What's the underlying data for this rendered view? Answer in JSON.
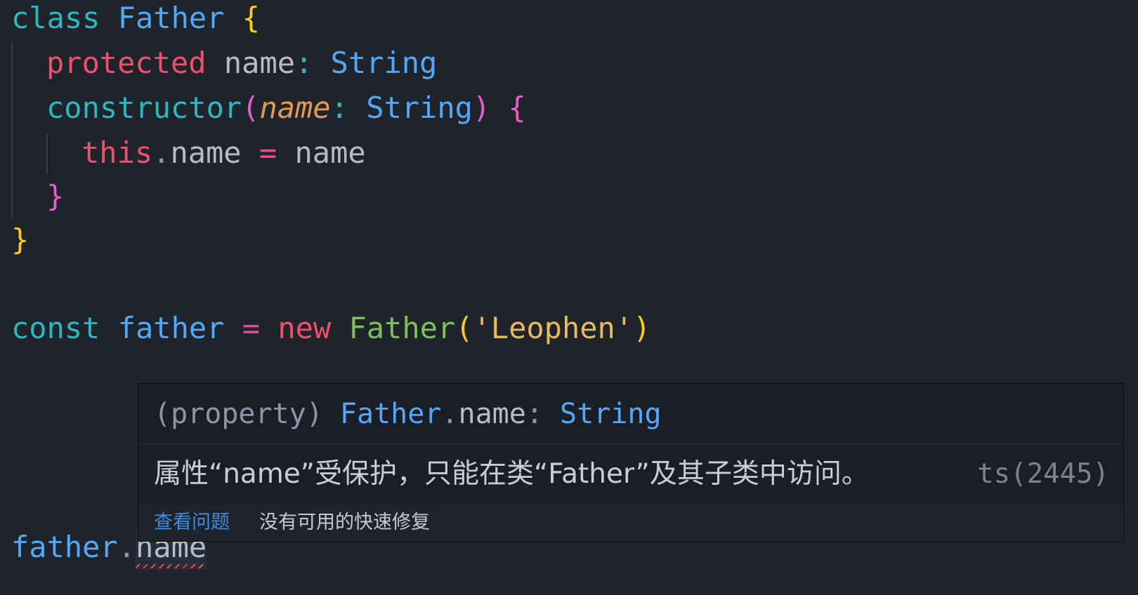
{
  "theme": {
    "background": "#1f232a",
    "accent_blue": "#52a8ff",
    "error_red": "#e5484d"
  },
  "code": {
    "line1": {
      "kw": "class",
      "name": "Father",
      "brace": "{"
    },
    "line2": {
      "mod": "protected",
      "prop": "name",
      "colon": ":",
      "type": "String"
    },
    "line3": {
      "kw": "constructor",
      "paren_open": "(",
      "param": "name",
      "colon": ":",
      "type": "String",
      "paren_close": ")",
      "brace": "{"
    },
    "line4": {
      "this": "this",
      "dot": ".",
      "prop": "name",
      "eq": "=",
      "value": "name"
    },
    "line5": {
      "brace": "}"
    },
    "line6": {
      "brace": "}"
    },
    "line7": {
      "kw": "const",
      "var": "father",
      "eq": "=",
      "new": "new",
      "cls": "Father",
      "paren_open": "(",
      "arg": "'Leophen'",
      "paren_close": ")"
    },
    "line8": {
      "obj": "father",
      "dot": ".",
      "prop": "name"
    }
  },
  "hover": {
    "signature": {
      "prefix": "(property)",
      "owner": "Father",
      "dot": ".",
      "member": "name",
      "colon": ":",
      "type": "String"
    },
    "message": "属性“name”受保护，只能在类“Father”及其子类中访问。",
    "code": "ts(2445)",
    "actions": {
      "view_problem": "查看问题",
      "no_quick_fix": "没有可用的快速修复"
    }
  }
}
